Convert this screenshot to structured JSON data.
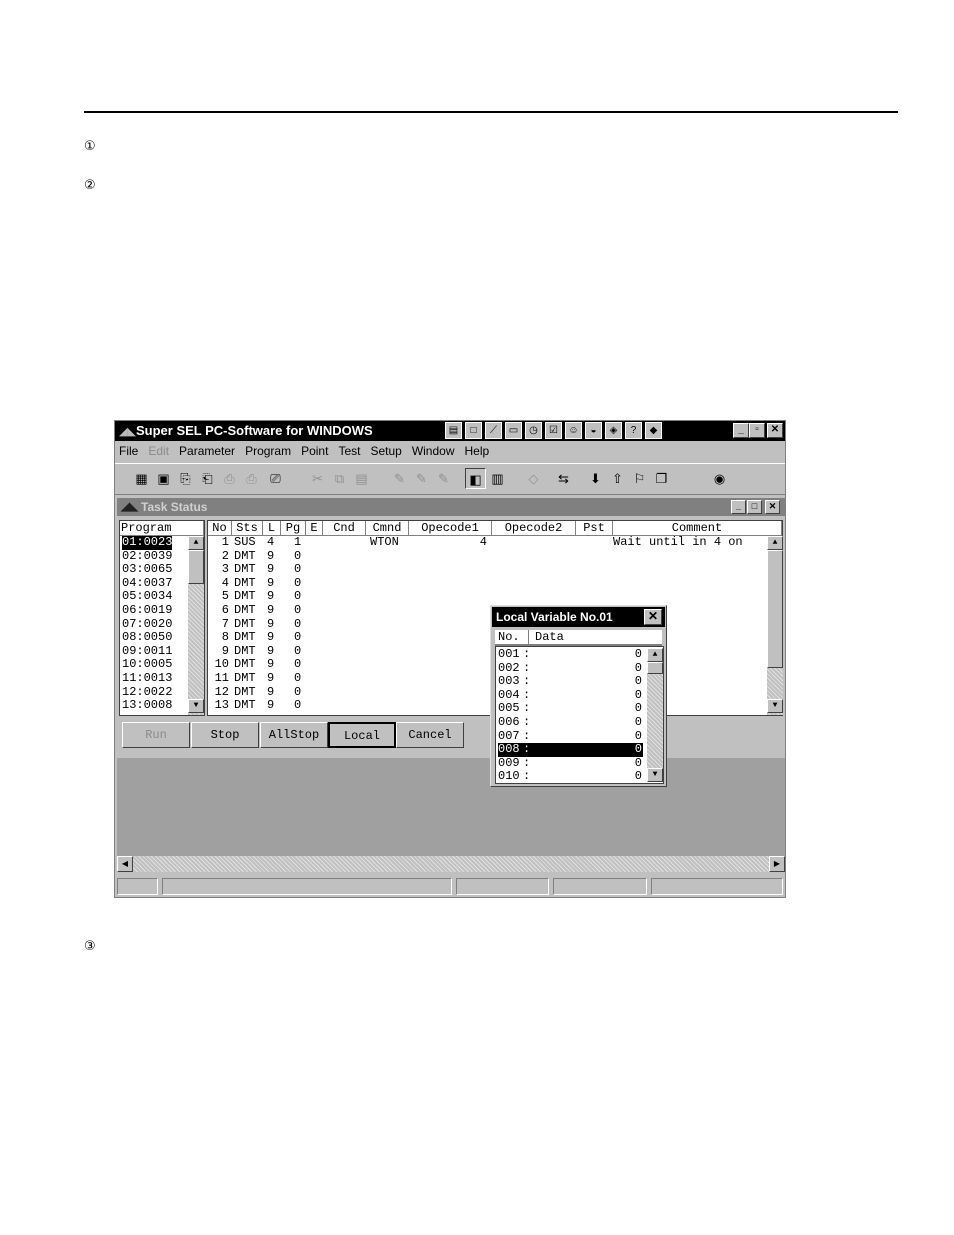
{
  "page": {
    "markers": [
      "①",
      "②",
      "③"
    ]
  },
  "app": {
    "title": "Super SEL PC-Software for WINDOWS",
    "menu": [
      "File",
      "Edit",
      "Parameter",
      "Program",
      "Point",
      "Test",
      "Setup",
      "Window",
      "Help"
    ],
    "menu_disabled": [
      "Edit"
    ],
    "window_buttons": [
      "_",
      "▫",
      "✕"
    ]
  },
  "task_window": {
    "title": "Task Status",
    "program_header": "Program",
    "programs": [
      "01:0023",
      "02:0039",
      "03:0065",
      "04:0037",
      "05:0034",
      "06:0019",
      "07:0020",
      "08:0050",
      "09:0011",
      "10:0005",
      "11:0013",
      "12:0022",
      "13:0008"
    ],
    "columns": [
      "No",
      "Sts",
      "L",
      "Pg",
      "E",
      "Cnd",
      "Cmnd",
      "Opecode1",
      "Opecode2",
      "Pst",
      "Comment"
    ],
    "rows": [
      {
        "no": "1",
        "sts": "SUS",
        "l": "4",
        "pg": "1",
        "e": "",
        "cnd": "",
        "cmnd": "WTON",
        "op1": "4",
        "op2": "",
        "pst": "",
        "comment": "Wait until in 4 on"
      },
      {
        "no": "2",
        "sts": "DMT",
        "l": "9",
        "pg": "0",
        "e": "",
        "cnd": "",
        "cmnd": "",
        "op1": "",
        "op2": "",
        "pst": "",
        "comment": ""
      },
      {
        "no": "3",
        "sts": "DMT",
        "l": "9",
        "pg": "0",
        "e": "",
        "cnd": "",
        "cmnd": "",
        "op1": "",
        "op2": "",
        "pst": "",
        "comment": ""
      },
      {
        "no": "4",
        "sts": "DMT",
        "l": "9",
        "pg": "0",
        "e": "",
        "cnd": "",
        "cmnd": "",
        "op1": "",
        "op2": "",
        "pst": "",
        "comment": ""
      },
      {
        "no": "5",
        "sts": "DMT",
        "l": "9",
        "pg": "0",
        "e": "",
        "cnd": "",
        "cmnd": "",
        "op1": "",
        "op2": "",
        "pst": "",
        "comment": ""
      },
      {
        "no": "6",
        "sts": "DMT",
        "l": "9",
        "pg": "0",
        "e": "",
        "cnd": "",
        "cmnd": "",
        "op1": "",
        "op2": "",
        "pst": "",
        "comment": ""
      },
      {
        "no": "7",
        "sts": "DMT",
        "l": "9",
        "pg": "0",
        "e": "",
        "cnd": "",
        "cmnd": "",
        "op1": "",
        "op2": "",
        "pst": "",
        "comment": ""
      },
      {
        "no": "8",
        "sts": "DMT",
        "l": "9",
        "pg": "0",
        "e": "",
        "cnd": "",
        "cmnd": "",
        "op1": "",
        "op2": "",
        "pst": "",
        "comment": ""
      },
      {
        "no": "9",
        "sts": "DMT",
        "l": "9",
        "pg": "0",
        "e": "",
        "cnd": "",
        "cmnd": "",
        "op1": "",
        "op2": "",
        "pst": "",
        "comment": ""
      },
      {
        "no": "10",
        "sts": "DMT",
        "l": "9",
        "pg": "0",
        "e": "",
        "cnd": "",
        "cmnd": "",
        "op1": "",
        "op2": "",
        "pst": "",
        "comment": ""
      },
      {
        "no": "11",
        "sts": "DMT",
        "l": "9",
        "pg": "0",
        "e": "",
        "cnd": "",
        "cmnd": "",
        "op1": "",
        "op2": "",
        "pst": "",
        "comment": ""
      },
      {
        "no": "12",
        "sts": "DMT",
        "l": "9",
        "pg": "0",
        "e": "",
        "cnd": "",
        "cmnd": "",
        "op1": "",
        "op2": "",
        "pst": "",
        "comment": ""
      },
      {
        "no": "13",
        "sts": "DMT",
        "l": "9",
        "pg": "0",
        "e": "",
        "cnd": "",
        "cmnd": "",
        "op1": "",
        "op2": "",
        "pst": "",
        "comment": ""
      }
    ],
    "buttons": {
      "run": "Run",
      "stop": "Stop",
      "allstop": "AllStop",
      "local": "Local",
      "cancel": "Cancel"
    }
  },
  "local_variable_window": {
    "title": "Local Variable No.01",
    "headers": {
      "no": "No.",
      "data": "Data"
    },
    "rows": [
      {
        "no": "001",
        "value": "0"
      },
      {
        "no": "002",
        "value": "0"
      },
      {
        "no": "003",
        "value": "0"
      },
      {
        "no": "004",
        "value": "0"
      },
      {
        "no": "005",
        "value": "0"
      },
      {
        "no": "006",
        "value": "0"
      },
      {
        "no": "007",
        "value": "0"
      },
      {
        "no": "008",
        "value": "0"
      },
      {
        "no": "009",
        "value": "0"
      },
      {
        "no": "010",
        "value": "0"
      }
    ],
    "selected_row": "008"
  }
}
